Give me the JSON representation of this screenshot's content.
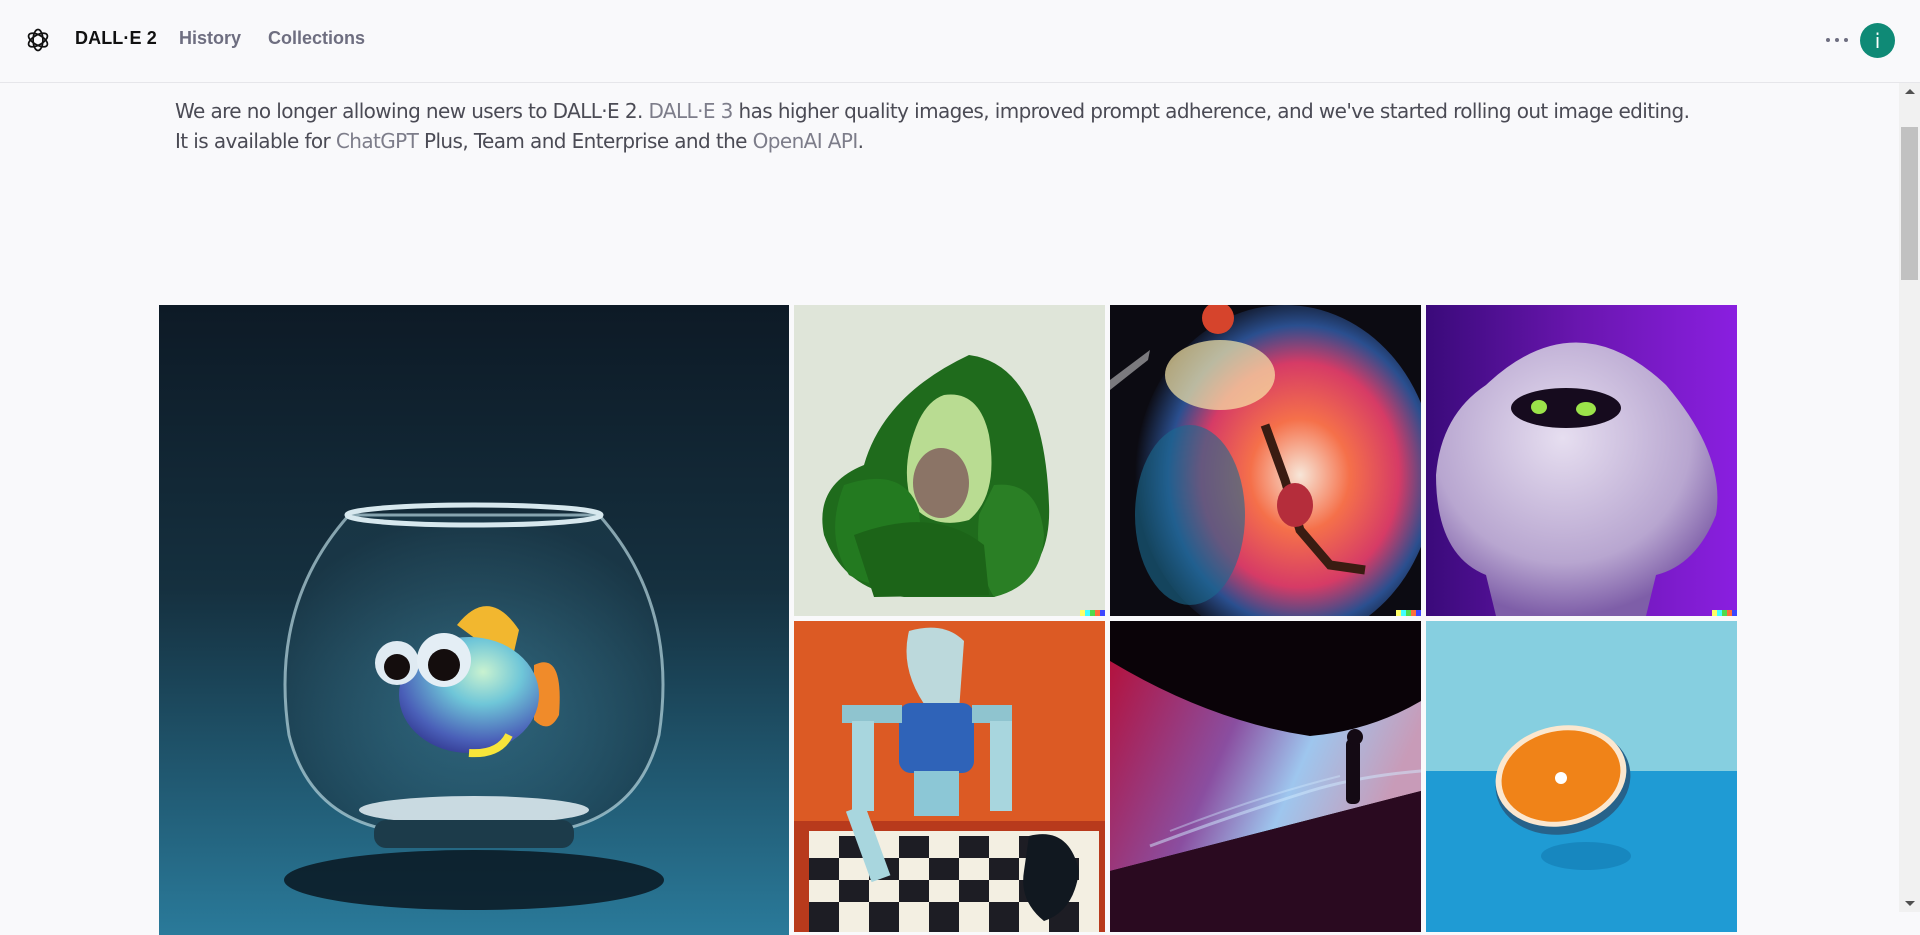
{
  "header": {
    "logo_icon": "openai-logo-icon",
    "title": "DALL·E 2",
    "nav": [
      {
        "label": "History"
      },
      {
        "label": "Collections"
      }
    ],
    "more_icon": "more-horizontal-icon",
    "avatar_initial": "i",
    "avatar_color": "#0f8a76"
  },
  "banner": {
    "text_1": "We are no longer allowing new users to DALL·E 2. ",
    "link_dalle3": "DALL·E 3",
    "text_2": " has higher quality images, improved prompt adherence, and we've started rolling out image editing. It is available for ",
    "link_chatgpt": "ChatGPT",
    "text_3": " Plus, Team and Enterprise and the ",
    "link_api": "OpenAI API",
    "text_4": "."
  },
  "gallery": {
    "images": [
      {
        "subject": "3D render of a cute rainbow fish in a glass fishbowl on dark teal background",
        "size": "large"
      },
      {
        "subject": "Armchair in the shape of an avocado",
        "size": "small",
        "signature": true
      },
      {
        "subject": "Oil painting of a basketball player dunking in a colorful nebula",
        "size": "small",
        "signature": true
      },
      {
        "subject": "Fluffy white monster with green eyes on purple background",
        "size": "small",
        "signature": true
      },
      {
        "subject": "Expressionist painting of a robot playing chess",
        "size": "small"
      },
      {
        "subject": "Silhouetted figure in surreal neon sand dunes",
        "size": "small"
      },
      {
        "subject": "Half orange on blue surface",
        "size": "small"
      }
    ],
    "signature_colors": [
      "#ffff66",
      "#42ffff",
      "#51da4c",
      "#ff6e3c",
      "#3c46ff"
    ]
  },
  "scrollbar": {
    "up_icon": "scroll-up-arrow-icon",
    "down_icon": "scroll-down-arrow-icon"
  }
}
